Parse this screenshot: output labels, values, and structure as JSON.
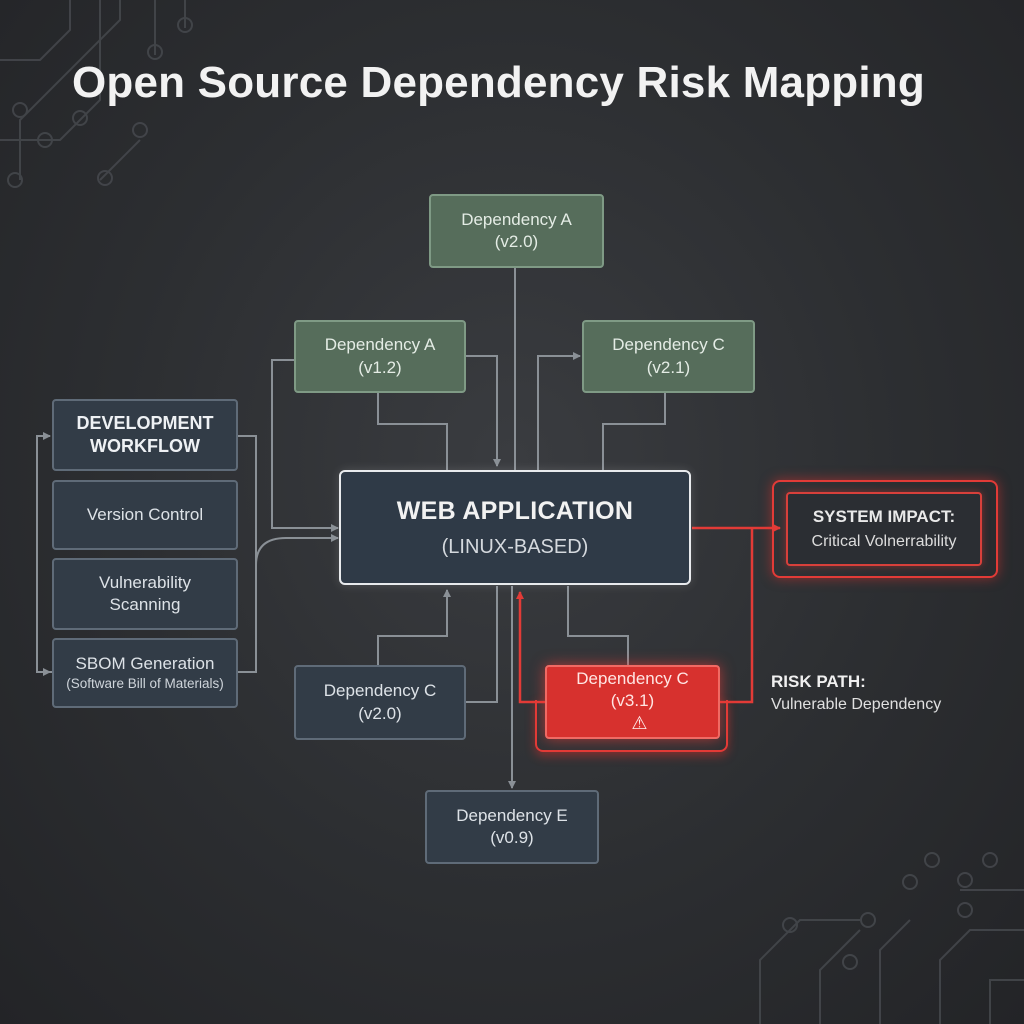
{
  "title": "Open Source Dependency Risk Mapping",
  "workflow": {
    "heading": [
      "DEVELOPMENT",
      "WORKFLOW"
    ],
    "items": [
      {
        "lines": [
          "Version Control"
        ]
      },
      {
        "lines": [
          "Vulnerability",
          "Scanning"
        ]
      },
      {
        "lines": [
          "SBOM Generation"
        ],
        "sub": "(Software Bill of Materials)"
      }
    ]
  },
  "center": {
    "line1": "WEB APPLICATION",
    "line2": "(LINUX-BASED)"
  },
  "dependencies": {
    "dep_a_top": {
      "name": "Dependency A",
      "version": "(v2.0)"
    },
    "dep_a_left": {
      "name": "Dependency A",
      "version": "(v1.2)"
    },
    "dep_c_right": {
      "name": "Dependency C",
      "version": "(v2.1)"
    },
    "dep_c_bottom": {
      "name": "Dependency C",
      "version": "(v2.0)"
    },
    "dep_c_risk": {
      "name": "Dependency C",
      "version": "(v3.1)",
      "icon": "warning-icon"
    },
    "dep_e": {
      "name": "Dependency E",
      "version": "(v0.9)"
    }
  },
  "impact": {
    "line1": "SYSTEM IMPACT:",
    "line2": "Critical Volnerrability"
  },
  "risk_path": {
    "line1": "RISK PATH:",
    "line2": "Vulnerable Dependency"
  },
  "colors": {
    "background": "#2c2e31",
    "connector": "#8a9096",
    "risk": "#e23b37",
    "green_node": "#566d5b",
    "slate_node": "#323c47"
  }
}
